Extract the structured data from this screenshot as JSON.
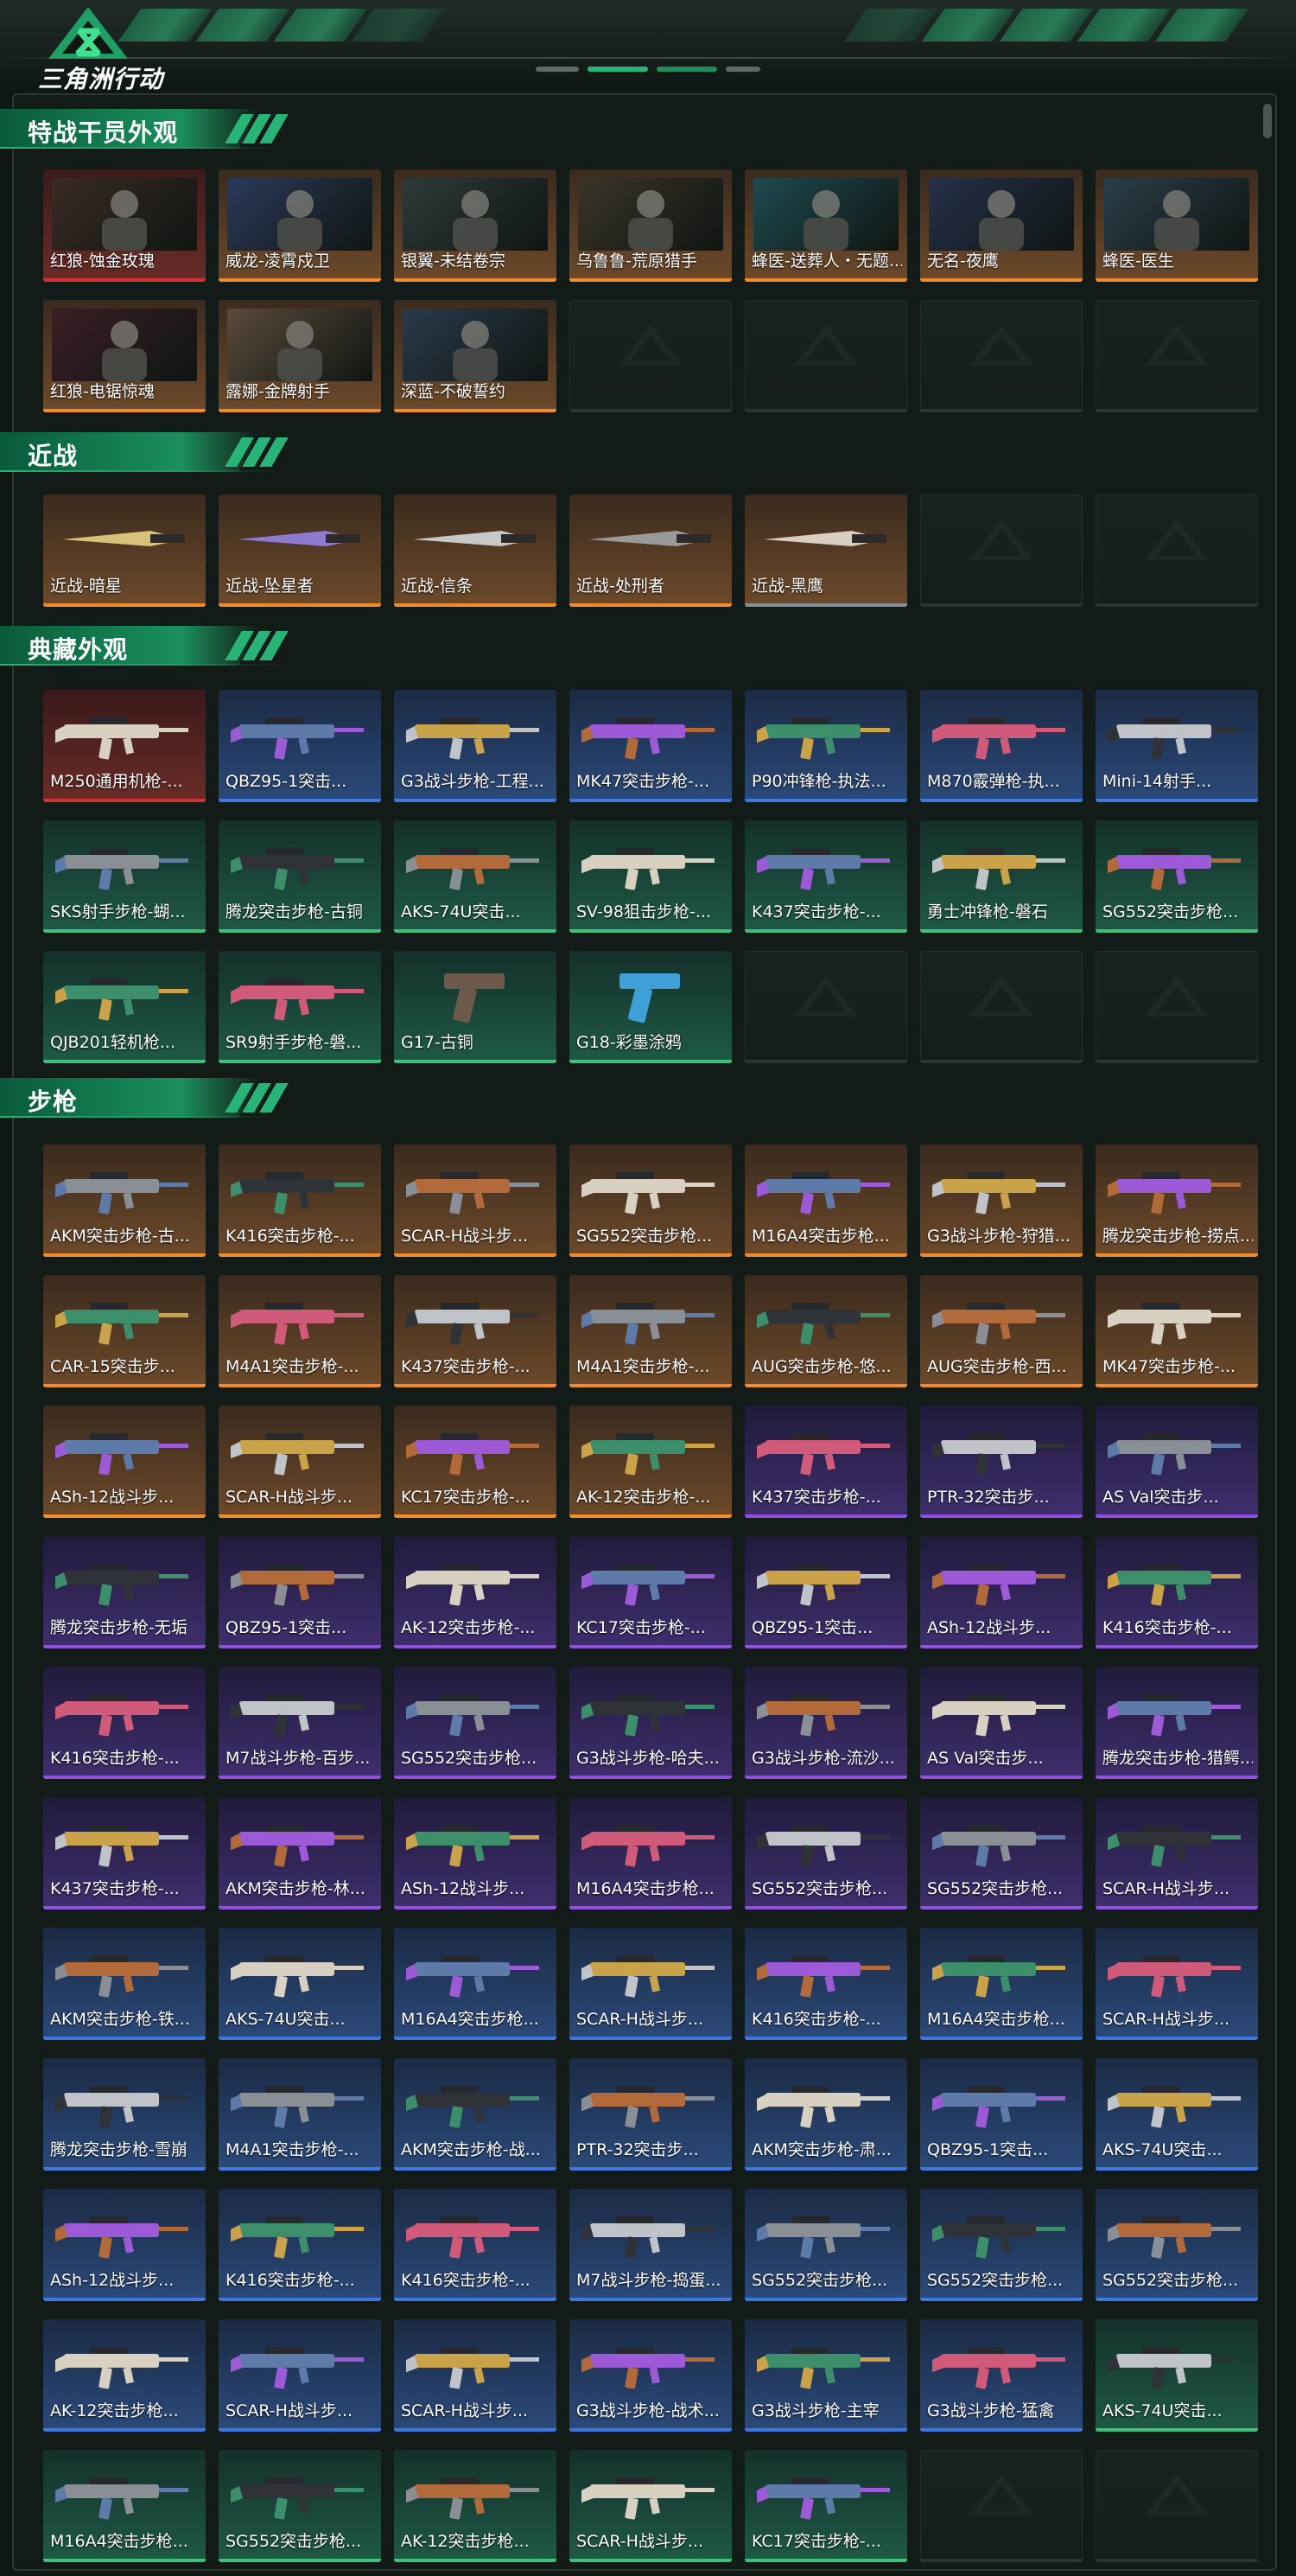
{
  "header": {
    "logo_text": "三角洲行动",
    "accent": "#28b377"
  },
  "sections": [
    {
      "title": "特战干员外观",
      "items": [
        {
          "label": "红狼-蚀金玫瑰",
          "rarity": "red",
          "kind": "operator"
        },
        {
          "label": "威龙-凌霄戍卫",
          "rarity": "orange",
          "kind": "operator"
        },
        {
          "label": "银翼-未结卷宗",
          "rarity": "orange",
          "kind": "operator"
        },
        {
          "label": "乌鲁鲁-荒原猎手",
          "rarity": "orange",
          "kind": "operator"
        },
        {
          "label": "蜂医-送葬人・无题...",
          "rarity": "orange",
          "kind": "operator"
        },
        {
          "label": "无名-夜鹰",
          "rarity": "orange",
          "kind": "operator"
        },
        {
          "label": "蜂医-医生",
          "rarity": "orange",
          "kind": "operator"
        },
        {
          "label": "红狼-电锯惊魂",
          "rarity": "orange",
          "kind": "operator"
        },
        {
          "label": "露娜-金牌射手",
          "rarity": "orange",
          "kind": "operator"
        },
        {
          "label": "深蓝-不破誓约",
          "rarity": "orange",
          "kind": "operator"
        },
        {
          "empty": true
        },
        {
          "empty": true
        },
        {
          "empty": true
        },
        {
          "empty": true
        }
      ]
    },
    {
      "title": "近战",
      "items": [
        {
          "label": "近战-暗星",
          "rarity": "orange",
          "kind": "melee"
        },
        {
          "label": "近战-坠星者",
          "rarity": "orange",
          "kind": "melee"
        },
        {
          "label": "近战-信条",
          "rarity": "orange",
          "kind": "melee"
        },
        {
          "label": "近战-处刑者",
          "rarity": "orange",
          "kind": "melee"
        },
        {
          "label": "近战-黑鹰",
          "rarity": "gray",
          "kind": "melee"
        },
        {
          "empty": true
        },
        {
          "empty": true
        }
      ]
    },
    {
      "title": "典藏外观",
      "items": [
        {
          "label": "M250通用机枪-...",
          "rarity": "red",
          "kind": "gun"
        },
        {
          "label": "QBZ95-1突击...",
          "rarity": "blue",
          "kind": "gun"
        },
        {
          "label": "G3战斗步枪-工程...",
          "rarity": "blue",
          "kind": "gun"
        },
        {
          "label": "MK47突击步枪-...",
          "rarity": "blue",
          "kind": "gun"
        },
        {
          "label": "P90冲锋枪-执法...",
          "rarity": "blue",
          "kind": "gun"
        },
        {
          "label": "M870霰弹枪-执...",
          "rarity": "blue",
          "kind": "gun"
        },
        {
          "label": "Mini-14射手...",
          "rarity": "blue",
          "kind": "gun"
        },
        {
          "label": "SKS射手步枪-蝴...",
          "rarity": "green",
          "kind": "gun"
        },
        {
          "label": "腾龙突击步枪-古铜",
          "rarity": "green",
          "kind": "gun"
        },
        {
          "label": "AKS-74U突击...",
          "rarity": "green",
          "kind": "gun"
        },
        {
          "label": "SV-98狙击步枪-...",
          "rarity": "green",
          "kind": "gun"
        },
        {
          "label": "K437突击步枪-...",
          "rarity": "green",
          "kind": "gun"
        },
        {
          "label": "勇士冲锋枪-磐石",
          "rarity": "green",
          "kind": "gun"
        },
        {
          "label": "SG552突击步枪...",
          "rarity": "green",
          "kind": "gun"
        },
        {
          "label": "QJB201轻机枪...",
          "rarity": "green",
          "kind": "gun"
        },
        {
          "label": "SR9射手步枪-磐...",
          "rarity": "green",
          "kind": "gun"
        },
        {
          "label": "G17-古铜",
          "rarity": "green",
          "kind": "pistol"
        },
        {
          "label": "G18-彩墨涂鸦",
          "rarity": "green",
          "kind": "pistol"
        },
        {
          "empty": true
        },
        {
          "empty": true
        },
        {
          "empty": true
        }
      ]
    },
    {
      "title": "步枪",
      "items": [
        {
          "label": "AKM突击步枪-古...",
          "rarity": "orange",
          "kind": "gun"
        },
        {
          "label": "K416突击步枪-...",
          "rarity": "orange",
          "kind": "gun"
        },
        {
          "label": "SCAR-H战斗步...",
          "rarity": "orange",
          "kind": "gun"
        },
        {
          "label": "SG552突击步枪...",
          "rarity": "orange",
          "kind": "gun"
        },
        {
          "label": "M16A4突击步枪...",
          "rarity": "orange",
          "kind": "gun"
        },
        {
          "label": "G3战斗步枪-狩猎...",
          "rarity": "orange",
          "kind": "gun"
        },
        {
          "label": "腾龙突击步枪-捞点...",
          "rarity": "orange",
          "kind": "gun"
        },
        {
          "label": "CAR-15突击步...",
          "rarity": "orange",
          "kind": "gun"
        },
        {
          "label": "M4A1突击步枪-...",
          "rarity": "orange",
          "kind": "gun"
        },
        {
          "label": "K437突击步枪-...",
          "rarity": "orange",
          "kind": "gun"
        },
        {
          "label": "M4A1突击步枪-...",
          "rarity": "orange",
          "kind": "gun"
        },
        {
          "label": "AUG突击步枪-悠...",
          "rarity": "orange",
          "kind": "gun"
        },
        {
          "label": "AUG突击步枪-西...",
          "rarity": "orange",
          "kind": "gun"
        },
        {
          "label": "MK47突击步枪-...",
          "rarity": "orange",
          "kind": "gun"
        },
        {
          "label": "ASh-12战斗步...",
          "rarity": "orange",
          "kind": "gun"
        },
        {
          "label": "SCAR-H战斗步...",
          "rarity": "orange",
          "kind": "gun"
        },
        {
          "label": "KC17突击步枪-...",
          "rarity": "orange",
          "kind": "gun"
        },
        {
          "label": "AK-12突击步枪-...",
          "rarity": "orange",
          "kind": "gun"
        },
        {
          "label": "K437突击步枪-...",
          "rarity": "purple",
          "kind": "gun"
        },
        {
          "label": "PTR-32突击步...",
          "rarity": "purple",
          "kind": "gun"
        },
        {
          "label": "AS Val突击步...",
          "rarity": "purple",
          "kind": "gun"
        },
        {
          "label": "腾龙突击步枪-无垢",
          "rarity": "purple",
          "kind": "gun"
        },
        {
          "label": "QBZ95-1突击...",
          "rarity": "purple",
          "kind": "gun"
        },
        {
          "label": "AK-12突击步枪-...",
          "rarity": "purple",
          "kind": "gun"
        },
        {
          "label": "KC17突击步枪-...",
          "rarity": "purple",
          "kind": "gun"
        },
        {
          "label": "QBZ95-1突击...",
          "rarity": "purple",
          "kind": "gun"
        },
        {
          "label": "ASh-12战斗步...",
          "rarity": "purple",
          "kind": "gun"
        },
        {
          "label": "K416突击步枪-...",
          "rarity": "purple",
          "kind": "gun"
        },
        {
          "label": "K416突击步枪-...",
          "rarity": "purple",
          "kind": "gun"
        },
        {
          "label": "M7战斗步枪-百步...",
          "rarity": "purple",
          "kind": "gun"
        },
        {
          "label": "SG552突击步枪...",
          "rarity": "purple",
          "kind": "gun"
        },
        {
          "label": "G3战斗步枪-哈夫...",
          "rarity": "purple",
          "kind": "gun"
        },
        {
          "label": "G3战斗步枪-流沙...",
          "rarity": "purple",
          "kind": "gun"
        },
        {
          "label": "AS Val突击步...",
          "rarity": "purple",
          "kind": "gun"
        },
        {
          "label": "腾龙突击步枪-猎鳄...",
          "rarity": "purple",
          "kind": "gun"
        },
        {
          "label": "K437突击步枪-...",
          "rarity": "purple",
          "kind": "gun"
        },
        {
          "label": "AKM突击步枪-林...",
          "rarity": "purple",
          "kind": "gun"
        },
        {
          "label": "ASh-12战斗步...",
          "rarity": "purple",
          "kind": "gun"
        },
        {
          "label": "M16A4突击步枪...",
          "rarity": "purple",
          "kind": "gun"
        },
        {
          "label": "SG552突击步枪...",
          "rarity": "purple",
          "kind": "gun"
        },
        {
          "label": "SG552突击步枪...",
          "rarity": "purple",
          "kind": "gun"
        },
        {
          "label": "SCAR-H战斗步...",
          "rarity": "purple",
          "kind": "gun"
        },
        {
          "label": "AKM突击步枪-铁...",
          "rarity": "blue",
          "kind": "gun"
        },
        {
          "label": "AKS-74U突击...",
          "rarity": "blue",
          "kind": "gun"
        },
        {
          "label": "M16A4突击步枪...",
          "rarity": "blue",
          "kind": "gun"
        },
        {
          "label": "SCAR-H战斗步...",
          "rarity": "blue",
          "kind": "gun"
        },
        {
          "label": "K416突击步枪-...",
          "rarity": "blue",
          "kind": "gun"
        },
        {
          "label": "M16A4突击步枪...",
          "rarity": "blue",
          "kind": "gun"
        },
        {
          "label": "SCAR-H战斗步...",
          "rarity": "blue",
          "kind": "gun"
        },
        {
          "label": "腾龙突击步枪-雪崩",
          "rarity": "blue",
          "kind": "gun"
        },
        {
          "label": "M4A1突击步枪-...",
          "rarity": "blue",
          "kind": "gun"
        },
        {
          "label": "AKM突击步枪-战...",
          "rarity": "blue",
          "kind": "gun"
        },
        {
          "label": "PTR-32突击步...",
          "rarity": "blue",
          "kind": "gun"
        },
        {
          "label": "AKM突击步枪-肃...",
          "rarity": "blue",
          "kind": "gun"
        },
        {
          "label": "QBZ95-1突击...",
          "rarity": "blue",
          "kind": "gun"
        },
        {
          "label": "AKS-74U突击...",
          "rarity": "blue",
          "kind": "gun"
        },
        {
          "label": "ASh-12战斗步...",
          "rarity": "blue",
          "kind": "gun"
        },
        {
          "label": "K416突击步枪-...",
          "rarity": "blue",
          "kind": "gun"
        },
        {
          "label": "K416突击步枪-...",
          "rarity": "blue",
          "kind": "gun"
        },
        {
          "label": "M7战斗步枪-捣蛋...",
          "rarity": "blue",
          "kind": "gun"
        },
        {
          "label": "SG552突击步枪...",
          "rarity": "blue",
          "kind": "gun"
        },
        {
          "label": "SG552突击步枪...",
          "rarity": "blue",
          "kind": "gun"
        },
        {
          "label": "SG552突击步枪...",
          "rarity": "blue",
          "kind": "gun"
        },
        {
          "label": "AK-12突击步枪...",
          "rarity": "blue",
          "kind": "gun"
        },
        {
          "label": "SCAR-H战斗步...",
          "rarity": "blue",
          "kind": "gun"
        },
        {
          "label": "SCAR-H战斗步...",
          "rarity": "blue",
          "kind": "gun"
        },
        {
          "label": "G3战斗步枪-战术...",
          "rarity": "blue",
          "kind": "gun"
        },
        {
          "label": "G3战斗步枪-主宰",
          "rarity": "blue",
          "kind": "gun"
        },
        {
          "label": "G3战斗步枪-猛禽",
          "rarity": "blue",
          "kind": "gun"
        },
        {
          "label": "AKS-74U突击...",
          "rarity": "green",
          "kind": "gun"
        },
        {
          "label": "M16A4突击步枪...",
          "rarity": "green",
          "kind": "gun"
        },
        {
          "label": "SG552突击步枪...",
          "rarity": "green",
          "kind": "gun"
        },
        {
          "label": "AK-12突击步枪...",
          "rarity": "green",
          "kind": "gun"
        },
        {
          "label": "SCAR-H战斗步...",
          "rarity": "green",
          "kind": "gun"
        },
        {
          "label": "KC17突击步枪-...",
          "rarity": "green",
          "kind": "gun"
        },
        {
          "empty": true
        },
        {
          "empty": true
        }
      ]
    }
  ]
}
